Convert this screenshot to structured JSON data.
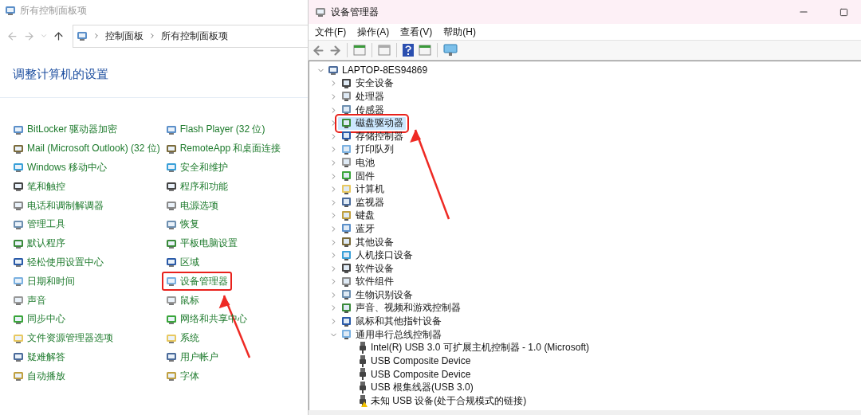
{
  "control_panel": {
    "title": "所有控制面板项",
    "breadcrumb": [
      "控制面板",
      "所有控制面板项"
    ],
    "heading": "调整计算机的设置",
    "columns": [
      [
        {
          "label": "BitLocker 驱动器加密",
          "highlighted": false
        },
        {
          "label": "Mail (Microsoft Outlook) (32 位)",
          "highlighted": false
        },
        {
          "label": "Windows 移动中心",
          "highlighted": false
        },
        {
          "label": "笔和触控",
          "highlighted": false
        },
        {
          "label": "电话和调制解调器",
          "highlighted": false
        },
        {
          "label": "管理工具",
          "highlighted": false
        },
        {
          "label": "默认程序",
          "highlighted": false
        },
        {
          "label": "轻松使用设置中心",
          "highlighted": false
        },
        {
          "label": "日期和时间",
          "highlighted": false
        },
        {
          "label": "声音",
          "highlighted": false
        },
        {
          "label": "同步中心",
          "highlighted": false
        },
        {
          "label": "文件资源管理器选项",
          "highlighted": false
        },
        {
          "label": "疑难解答",
          "highlighted": false
        },
        {
          "label": "自动播放",
          "highlighted": false
        }
      ],
      [
        {
          "label": "Flash Player (32 位)",
          "highlighted": false
        },
        {
          "label": "RemoteApp 和桌面连接",
          "highlighted": false
        },
        {
          "label": "安全和维护",
          "highlighted": false
        },
        {
          "label": "程序和功能",
          "highlighted": false
        },
        {
          "label": "电源选项",
          "highlighted": false
        },
        {
          "label": "恢复",
          "highlighted": false
        },
        {
          "label": "平板电脑设置",
          "highlighted": false
        },
        {
          "label": "区域",
          "highlighted": false
        },
        {
          "label": "设备管理器",
          "highlighted": true
        },
        {
          "label": "鼠标",
          "highlighted": false
        },
        {
          "label": "网络和共享中心",
          "highlighted": false
        },
        {
          "label": "系统",
          "highlighted": false
        },
        {
          "label": "用户帐户",
          "highlighted": false
        },
        {
          "label": "字体",
          "highlighted": false
        }
      ]
    ]
  },
  "device_manager": {
    "title": "设备管理器",
    "menu": [
      "文件(F)",
      "操作(A)",
      "查看(V)",
      "帮助(H)"
    ],
    "tree": {
      "label": "LAPTOP-8ES94869",
      "expanded": true,
      "children": [
        {
          "label": "安全设备",
          "expanded": false,
          "selected": false,
          "highlighted": false
        },
        {
          "label": "处理器",
          "expanded": false,
          "selected": false,
          "highlighted": false
        },
        {
          "label": "传感器",
          "expanded": false,
          "selected": false,
          "highlighted": false
        },
        {
          "label": "磁盘驱动器",
          "expanded": false,
          "selected": true,
          "highlighted": true
        },
        {
          "label": "存储控制器",
          "expanded": false,
          "selected": false,
          "highlighted": false
        },
        {
          "label": "打印队列",
          "expanded": false,
          "selected": false,
          "highlighted": false
        },
        {
          "label": "电池",
          "expanded": false,
          "selected": false,
          "highlighted": false
        },
        {
          "label": "固件",
          "expanded": false,
          "selected": false,
          "highlighted": false
        },
        {
          "label": "计算机",
          "expanded": false,
          "selected": false,
          "highlighted": false
        },
        {
          "label": "监视器",
          "expanded": false,
          "selected": false,
          "highlighted": false
        },
        {
          "label": "键盘",
          "expanded": false,
          "selected": false,
          "highlighted": false
        },
        {
          "label": "蓝牙",
          "expanded": false,
          "selected": false,
          "highlighted": false
        },
        {
          "label": "其他设备",
          "expanded": false,
          "selected": false,
          "highlighted": false
        },
        {
          "label": "人机接口设备",
          "expanded": false,
          "selected": false,
          "highlighted": false
        },
        {
          "label": "软件设备",
          "expanded": false,
          "selected": false,
          "highlighted": false
        },
        {
          "label": "软件组件",
          "expanded": false,
          "selected": false,
          "highlighted": false
        },
        {
          "label": "生物识别设备",
          "expanded": false,
          "selected": false,
          "highlighted": false
        },
        {
          "label": "声音、视频和游戏控制器",
          "expanded": false,
          "selected": false,
          "highlighted": false
        },
        {
          "label": "鼠标和其他指针设备",
          "expanded": false,
          "selected": false,
          "highlighted": false
        },
        {
          "label": "通用串行总线控制器",
          "expanded": true,
          "selected": false,
          "highlighted": false,
          "children": [
            {
              "label": "Intel(R) USB 3.0 可扩展主机控制器 - 1.0 (Microsoft)",
              "warning": false
            },
            {
              "label": "USB Composite Device",
              "warning": false
            },
            {
              "label": "USB Composite Device",
              "warning": false
            },
            {
              "label": "USB 根集线器(USB 3.0)",
              "warning": false
            },
            {
              "label": "未知 USB 设备(处于合规模式的链接)",
              "warning": true
            }
          ]
        }
      ]
    }
  }
}
